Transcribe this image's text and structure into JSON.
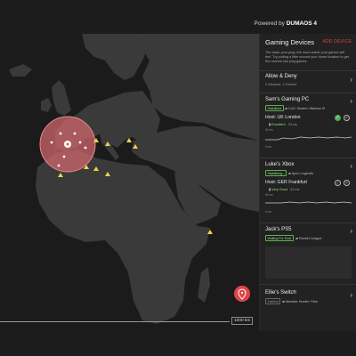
{
  "header": {
    "powered_prefix": "Powered by",
    "brand": "DUMAOS 4"
  },
  "colors": {
    "accent_red": "#e0434a",
    "geofence_fill": "#d96a6f",
    "server_marker": "#e8d44d",
    "ping_green": "#8fe07d"
  },
  "map": {
    "scale_label": "1000 km",
    "location_button_icon": "map-pin-icon"
  },
  "panel": {
    "title": "Gaming Devices",
    "add_device": "ADD DEVICE",
    "intro": "The lower your ping, the more stable your games will feel. Try putting a filter around your home location to get the nearest low ping games.",
    "allow_deny": {
      "title": "Allow & Deny",
      "subtitle": "2 Allowed, 1 Denied"
    },
    "devices": [
      {
        "name": "Sam's Gaming PC",
        "status": "Stabilised",
        "game": "CoD: Modern Warfare III",
        "host": "Host: UK London",
        "ping_quality": "Excellent",
        "ping_ms": "24 ms",
        "axis_top": "80 ms",
        "axis_bottom": "0 ms"
      },
      {
        "name": "Luke's Xbox",
        "status": "Stabilising...",
        "game": "Apex Legends",
        "host": "Host: GER Frankfurt",
        "ping_quality": "Very Good",
        "ping_ms": "41 ms",
        "axis_top": "80 ms",
        "axis_bottom": "0 ms"
      },
      {
        "name": "Jack's PS5",
        "status": "Waiting For Host",
        "game": "Rocket League"
      },
      {
        "name": "Ellie's Switch",
        "status": "Inactive",
        "game": "Monster Hunter: Rise"
      }
    ]
  }
}
